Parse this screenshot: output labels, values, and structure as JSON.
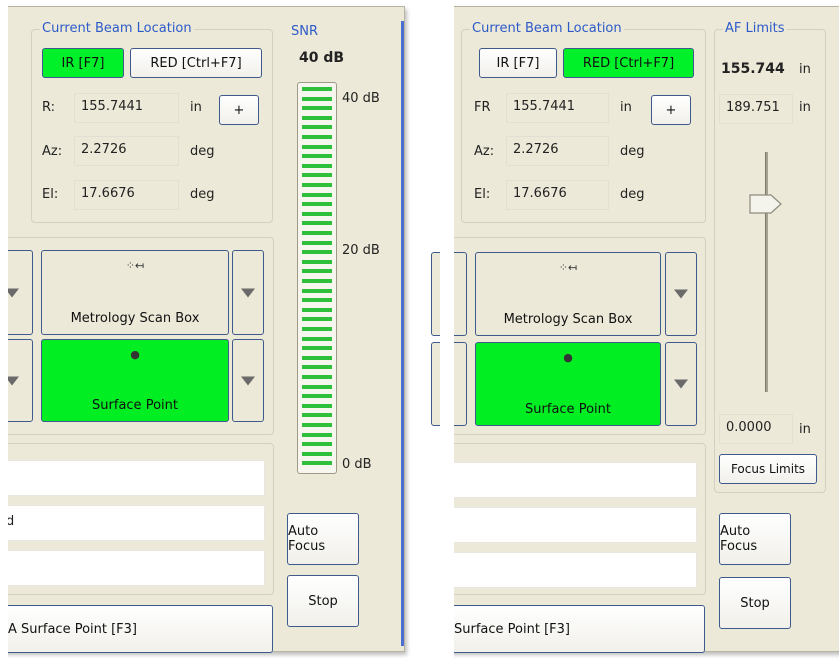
{
  "left": {
    "beam_title": "Current Beam Location",
    "ir_button": "IR [F7]",
    "red_button": "RED [Ctrl+F7]",
    "r_label": "R:",
    "r_value": "155.7441",
    "r_unit": "in",
    "plus_button": "+",
    "az_label": "Az:",
    "az_value": "2.2726",
    "az_unit": "deg",
    "el_label": "El:",
    "el_value": "17.6676",
    "el_unit": "deg",
    "snr_title": "SNR",
    "snr_value": "40 dB",
    "snr_top": "40 dB",
    "snr_mid": "20 dB",
    "snr_bottom": "0 dB",
    "snr_level_db": 40,
    "metrology_label": "Metrology Scan Box",
    "surface_label": "Surface Point",
    "row2_fragment": "d",
    "auto_focus": "Auto Focus",
    "stop": "Stop",
    "bottom_button": "Surface Point [F3]",
    "bottom_prefix": "A"
  },
  "right": {
    "beam_title": "Current Beam Location",
    "ir_button": "IR [F7]",
    "red_button": "RED [Ctrl+F7]",
    "r_label": "FR",
    "r_value": "155.7441",
    "r_unit": "in",
    "plus_button": "+",
    "az_label": "Az:",
    "az_value": "2.2726",
    "az_unit": "deg",
    "el_label": "El:",
    "el_value": "17.6676",
    "el_unit": "deg",
    "af_title": "AF Limits",
    "af_current": "155.744",
    "af_current_unit": "in",
    "af_max": "189.751",
    "af_max_unit": "in",
    "af_min": "0.0000",
    "af_min_unit": "in",
    "focus_limits": "Focus Limits",
    "metrology_label": "Metrology Scan Box",
    "surface_label": "Surface Point",
    "auto_focus": "Auto Focus",
    "stop": "Stop",
    "bottom_button": "Surface Point [F3]"
  },
  "colors": {
    "active_green": "#00f02a",
    "title_blue": "#2c5ac8",
    "meter_green": "#2fc03b"
  },
  "icons": [
    "scan-box-icon",
    "surface-point-icon",
    "dropdown-arrow-icon",
    "slider-thumb-icon"
  ]
}
